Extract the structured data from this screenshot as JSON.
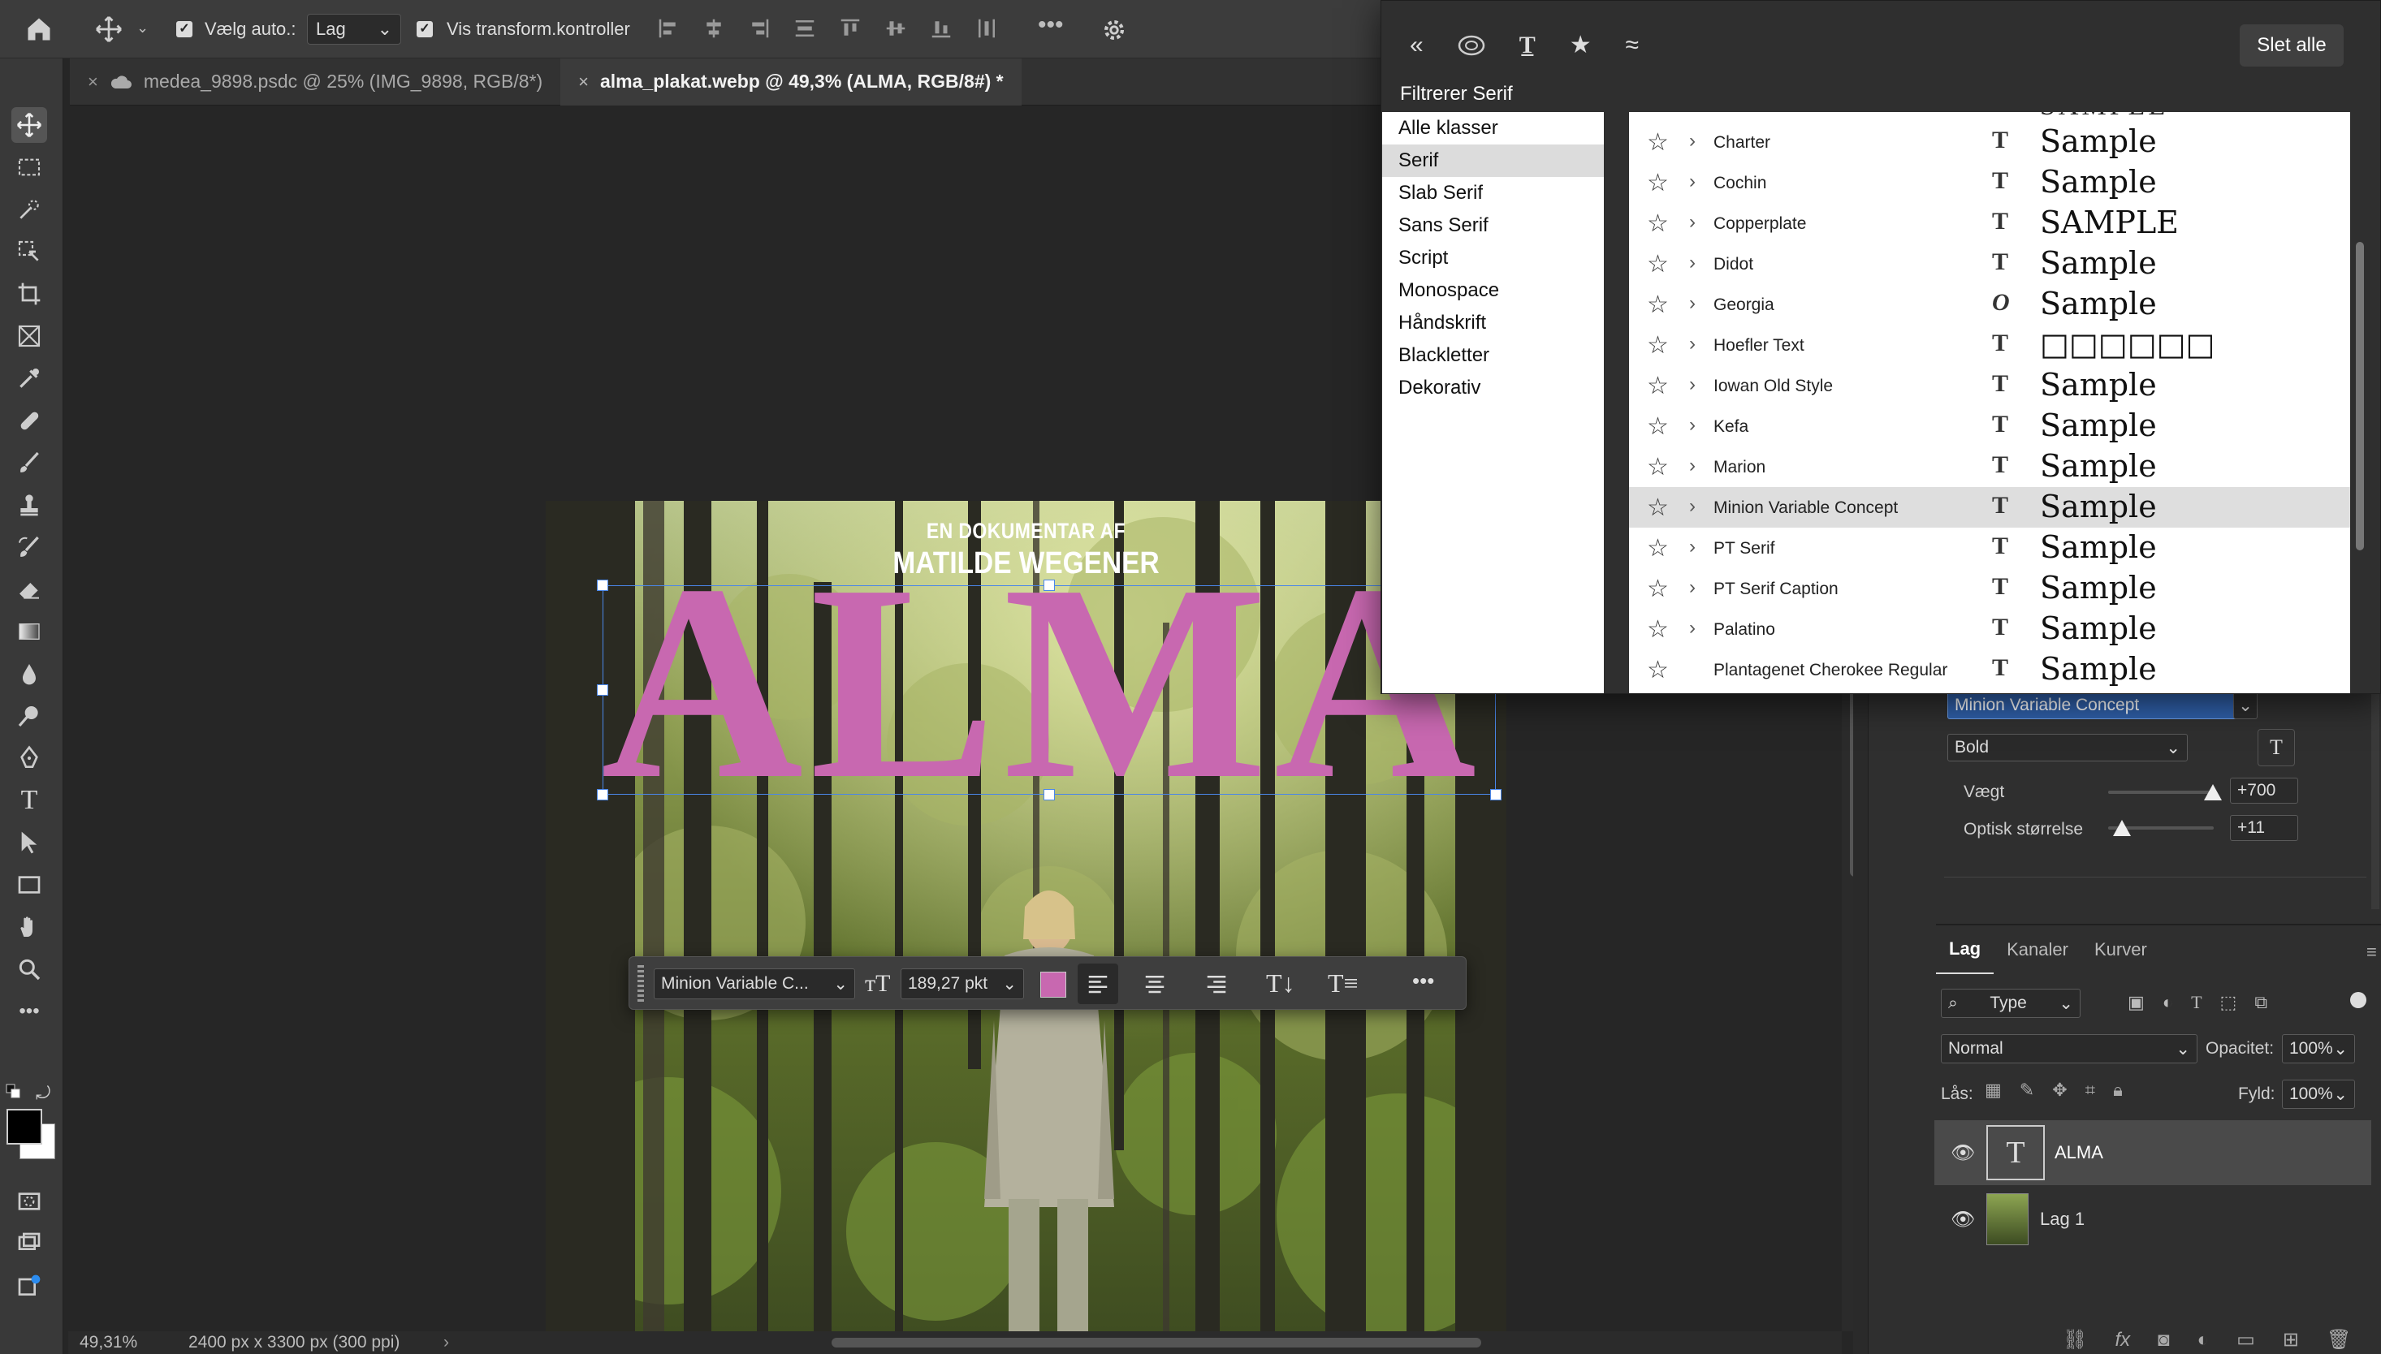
{
  "optbar": {
    "auto_select_label": "Vælg auto.:",
    "auto_select_value": "Lag",
    "transform_label": "Vis transform.kontroller"
  },
  "tabs": [
    {
      "label": "medea_9898.psdc @ 25% (IMG_9898, RGB/8*)"
    },
    {
      "label": "alma_plakat.webp @ 49,3% (ALMA, RGB/8#) *"
    }
  ],
  "poster": {
    "line1": "EN DOKUMENTAR AF",
    "line2": "MATILDE WEGENER",
    "title": "ALMA"
  },
  "ctxbar": {
    "font": "Minion Variable C...",
    "size": "189,27 pkt"
  },
  "status": {
    "zoom": "49,31%",
    "docsize": "2400 px x 3300 px (300 ppi)"
  },
  "fontpanel": {
    "delete_all": "Slet alle",
    "filter_label": "Filtrerer Serif",
    "classes": [
      "Alle klasser",
      "Serif",
      "Slab Serif",
      "Sans Serif",
      "Script",
      "Monospace",
      "Håndskrift",
      "Blackletter",
      "Dekorativ"
    ],
    "selected_class": "Serif",
    "fonts": [
      {
        "name": "Charter",
        "sample": "Sample"
      },
      {
        "name": "Cochin",
        "sample": "Sample"
      },
      {
        "name": "Copperplate",
        "sample": "SAMPLE"
      },
      {
        "name": "Didot",
        "sample": "Sample"
      },
      {
        "name": "Georgia",
        "sample": "Sample"
      },
      {
        "name": "Hoefler Text",
        "sample": "□□□□□□"
      },
      {
        "name": "Iowan Old Style",
        "sample": "Sample"
      },
      {
        "name": "Kefa",
        "sample": "Sample"
      },
      {
        "name": "Marion",
        "sample": "Sample"
      },
      {
        "name": "Minion Variable Concept",
        "sample": "Sample"
      },
      {
        "name": "PT Serif",
        "sample": "Sample"
      },
      {
        "name": "PT Serif Caption",
        "sample": "Sample"
      },
      {
        "name": "Palatino",
        "sample": "Sample"
      },
      {
        "name": "Plantagenet Cherokee Regular",
        "sample": "Sample"
      }
    ],
    "top_partial_sample": "SAMPLE"
  },
  "character": {
    "font_family": "Minion Variable Concept",
    "font_style": "Bold",
    "weight_label": "Vægt",
    "weight_value": "+700",
    "optical_label": "Optisk størrelse",
    "optical_value": "+11"
  },
  "layers": {
    "tabs": [
      "Lag",
      "Kanaler",
      "Kurver"
    ],
    "filter": "Type",
    "blend": "Normal",
    "opacity_label": "Opacitet:",
    "opacity": "100%",
    "lock_label": "Lås:",
    "fill_label": "Fyld:",
    "fill": "100%",
    "items": [
      {
        "name": "ALMA"
      },
      {
        "name": "Lag 1"
      }
    ]
  },
  "colors": {
    "accent": "#c868b0",
    "selection_blue": "#2f6fd1"
  }
}
